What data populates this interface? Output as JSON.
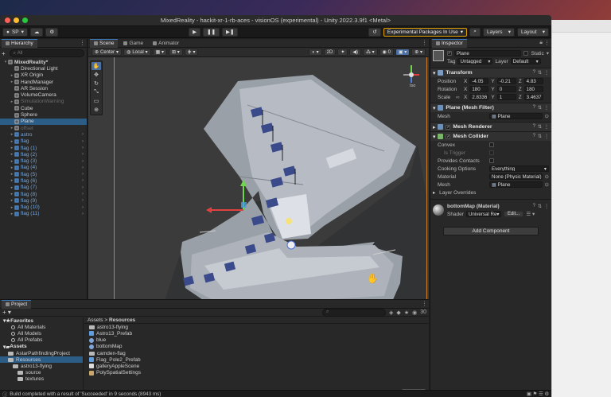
{
  "window": {
    "title": "MixedReality - hackit-xr-1-rb-aces - visionOS (experimental) - Unity 2022.3.9f1 <Metal>",
    "traffic_colors": [
      "#fe5f57",
      "#febc2e",
      "#28c840"
    ]
  },
  "toolbar": {
    "account": "SP",
    "packages": "Experimental Packages In Use",
    "layers": "Layers",
    "layout": "Layout"
  },
  "hierarchy": {
    "tab": "Hierarchy",
    "search_placeholder": "All",
    "items": [
      {
        "label": "MixedReality*",
        "indent": 0,
        "style": "root"
      },
      {
        "label": "Directional Light",
        "indent": 2,
        "style": "normal"
      },
      {
        "label": "XR Origin",
        "indent": 2,
        "style": "normal"
      },
      {
        "label": "HandManager",
        "indent": 2,
        "style": "normal"
      },
      {
        "label": "AR Session",
        "indent": 2,
        "style": "normal"
      },
      {
        "label": "VolumeCamera",
        "indent": 2,
        "style": "normal"
      },
      {
        "label": "SimulationWarning",
        "indent": 2,
        "style": "dim"
      },
      {
        "label": "Cube",
        "indent": 2,
        "style": "normal"
      },
      {
        "label": "Sphere",
        "indent": 2,
        "style": "normal"
      },
      {
        "label": "Plane",
        "indent": 2,
        "style": "sel"
      },
      {
        "label": "offset",
        "indent": 2,
        "style": "dim"
      },
      {
        "label": "astro",
        "indent": 2,
        "style": "blue"
      },
      {
        "label": "flag",
        "indent": 2,
        "style": "blue"
      },
      {
        "label": "flag (1)",
        "indent": 2,
        "style": "blue"
      },
      {
        "label": "flag (2)",
        "indent": 2,
        "style": "blue"
      },
      {
        "label": "flag (3)",
        "indent": 2,
        "style": "blue"
      },
      {
        "label": "flag (4)",
        "indent": 2,
        "style": "blue"
      },
      {
        "label": "flag (5)",
        "indent": 2,
        "style": "blue"
      },
      {
        "label": "flag (6)",
        "indent": 2,
        "style": "blue"
      },
      {
        "label": "flag (7)",
        "indent": 2,
        "style": "blue"
      },
      {
        "label": "flag (8)",
        "indent": 2,
        "style": "blue"
      },
      {
        "label": "flag (9)",
        "indent": 2,
        "style": "blue"
      },
      {
        "label": "flag (10)",
        "indent": 2,
        "style": "blue"
      },
      {
        "label": "flag (11)",
        "indent": 2,
        "style": "blue"
      }
    ]
  },
  "scene": {
    "tabs": [
      "Scene",
      "Game",
      "Animator"
    ],
    "pivot": "Center",
    "space": "Local",
    "mode_2d": "2D",
    "persp": "Iso"
  },
  "inspector": {
    "tab": "Inspector",
    "object_name": "Plane",
    "static_label": "Static",
    "tag_label": "Tag",
    "tag_value": "Untagged",
    "layer_label": "Layer",
    "layer_value": "Default",
    "transform": {
      "title": "Transform",
      "position_label": "Position",
      "rotation_label": "Rotation",
      "scale_label": "Scale",
      "position": {
        "x": "-4.05",
        "y": "-0.21",
        "z": "4.83"
      },
      "rotation": {
        "x": "180",
        "y": "0",
        "z": "180"
      },
      "scale": {
        "x": "2.8336",
        "y": "1",
        "z": "3.4637"
      }
    },
    "mesh_filter": {
      "title": "Plane (Mesh Filter)",
      "mesh_label": "Mesh",
      "mesh_value": "Plane"
    },
    "mesh_renderer": {
      "title": "Mesh Renderer"
    },
    "mesh_collider": {
      "title": "Mesh Collider",
      "convex": "Convex",
      "is_trigger": "Is Trigger",
      "contacts": "Provides Contacts",
      "cooking_label": "Cooking Options",
      "cooking_value": "Everything",
      "material_label": "Material",
      "material_value": "None (Physic Material)",
      "mesh_label": "Mesh",
      "mesh_value": "Plane"
    },
    "layer_overrides": "Layer Overrides",
    "material": {
      "name": "bottomMap (Material)",
      "shader_label": "Shader",
      "shader_value": "Universal Re",
      "edit": "Edit..."
    },
    "add_component": "Add Component"
  },
  "project": {
    "tab": "Project",
    "count": "30",
    "breadcrumb": [
      "Assets",
      "Resources"
    ],
    "left": [
      {
        "label": "Favorites",
        "type": "head"
      },
      {
        "label": "All Materials",
        "type": "search"
      },
      {
        "label": "All Models",
        "type": "search"
      },
      {
        "label": "All Prefabs",
        "type": "search"
      },
      {
        "label": "Assets",
        "type": "head"
      },
      {
        "label": "AstarPathfindingProject",
        "type": "folder"
      },
      {
        "label": "Resources",
        "type": "folder-sel"
      },
      {
        "label": "astro13-flying",
        "type": "folder"
      },
      {
        "label": "source",
        "type": "folder"
      },
      {
        "label": "textures",
        "type": "folder"
      }
    ],
    "files": [
      {
        "label": "astro13-flying",
        "kind": "folder"
      },
      {
        "label": "Astro13_Prefab",
        "kind": "prefab"
      },
      {
        "label": "blue",
        "kind": "material"
      },
      {
        "label": "bottomMap",
        "kind": "material"
      },
      {
        "label": "camden-flag",
        "kind": "folder"
      },
      {
        "label": "Flag_Pole2_Prefab",
        "kind": "prefab"
      },
      {
        "label": "galleryAppleScene",
        "kind": "scene"
      },
      {
        "label": "PolySpatialSettings",
        "kind": "asset"
      }
    ]
  },
  "status": "Build completed with a result of 'Succeeded' in 9 seconds (8943 ms)"
}
